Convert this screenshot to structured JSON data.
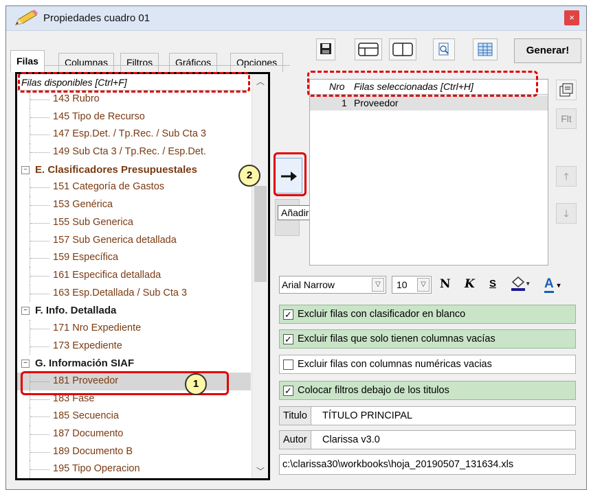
{
  "window": {
    "title": "Propiedades cuadro 01",
    "close_label": "×"
  },
  "tabs": [
    {
      "label": "Filas",
      "active": true
    },
    {
      "label": "Columnas"
    },
    {
      "label": "Filtros"
    },
    {
      "label": "Gráficos"
    },
    {
      "label": "Opciones"
    }
  ],
  "toolbar": {
    "generate_label": "Generar!"
  },
  "left_panel": {
    "header": "Filas disponibles     [Ctrl+F]",
    "items": [
      {
        "label": "143 Rubro",
        "kind": "child"
      },
      {
        "label": "145 Tipo de Recurso",
        "kind": "child"
      },
      {
        "label": "147 Esp.Det. / Tp.Rec. / Sub Cta 3",
        "kind": "child"
      },
      {
        "label": "149 Sub Cta 3 / Tp.Rec. / Esp.Det.",
        "kind": "child"
      },
      {
        "label": "E. Clasificadores Presupuestales",
        "kind": "group",
        "color": "brown"
      },
      {
        "label": "151 Categoría de Gastos",
        "kind": "child"
      },
      {
        "label": "153 Genérica",
        "kind": "child"
      },
      {
        "label": "155 Sub Generica",
        "kind": "child"
      },
      {
        "label": "157 Sub Generica detallada",
        "kind": "child"
      },
      {
        "label": "159 Específica",
        "kind": "child"
      },
      {
        "label": "161 Especifica detallada",
        "kind": "child"
      },
      {
        "label": "163 Esp.Detallada / Sub Cta 3",
        "kind": "child"
      },
      {
        "label": "F. Info. Detallada",
        "kind": "group",
        "color": "dark"
      },
      {
        "label": "171 Nro Expediente",
        "kind": "child"
      },
      {
        "label": "173 Expediente",
        "kind": "child"
      },
      {
        "label": "G. Información SIAF",
        "kind": "group",
        "color": "dark"
      },
      {
        "label": "181 Proveedor",
        "kind": "child",
        "selected": true
      },
      {
        "label": "183 Fase",
        "kind": "child"
      },
      {
        "label": "185 Secuencia",
        "kind": "child"
      },
      {
        "label": "187 Documento",
        "kind": "child"
      },
      {
        "label": "189 Documento B",
        "kind": "child"
      },
      {
        "label": "195 Tipo Operacion",
        "kind": "child"
      }
    ]
  },
  "middle": {
    "add_row_tooltip": "Añadir Fila"
  },
  "right_panel": {
    "col_nro": "Nro",
    "col_title": "Filas seleccionadas     [Ctrl+H]",
    "rows": [
      {
        "nro": "1",
        "label": "Proveedor"
      }
    ],
    "side_buttons": {
      "filter": "Flt"
    }
  },
  "format": {
    "font": "Arial Narrow",
    "size": "10",
    "bold": "N",
    "italic": "K",
    "underline": "S",
    "font_color_letter": "A"
  },
  "options": [
    {
      "label": "Excluir filas con clasificador en blanco",
      "checked": true
    },
    {
      "label": "Excluir filas que solo tienen columnas vacías",
      "checked": true
    },
    {
      "label": "Excluir filas con columnas numéricas vacias",
      "checked": false
    },
    {
      "label": "Colocar filtros debajo de los titulos",
      "checked": true
    }
  ],
  "fields": {
    "title_label": "Titulo",
    "title_value": "TÍTULO PRINCIPAL",
    "author_label": "Autor",
    "author_value": "Clarissa v3.0",
    "path": "c:\\clarissa30\\workbooks\\hoja_20190507_131634.xls"
  },
  "annotations": {
    "marker1": "1",
    "marker2": "2"
  },
  "colors": {
    "highlight": "#e00000",
    "option_green": "#c9e4c7",
    "item_brown": "#7a3a12"
  }
}
